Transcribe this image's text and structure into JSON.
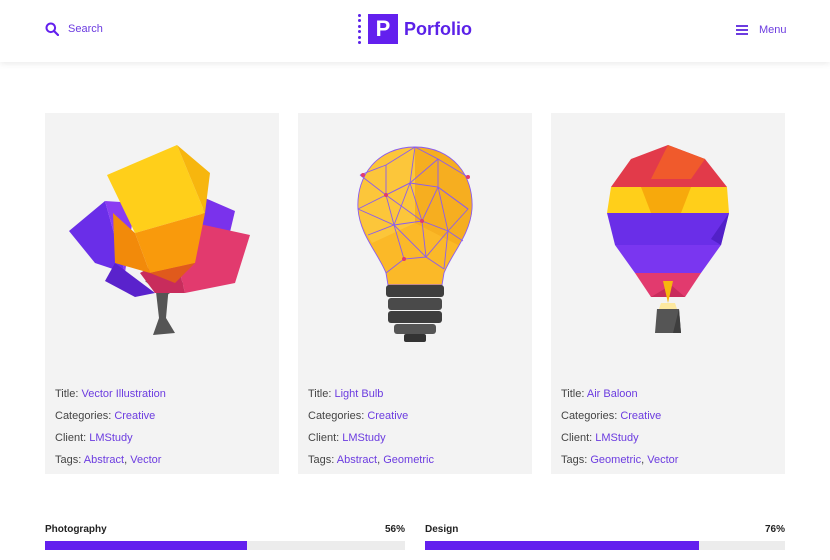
{
  "header": {
    "search_label": "Search",
    "logo_letter": "P",
    "logo_text": "Porfolio",
    "menu_label": "Menu",
    "accent_color": "#6320ee"
  },
  "cards": [
    {
      "image": "low-poly-tree",
      "title_label": "Title:",
      "title": "Vector Illustration",
      "categories_label": "Categories:",
      "categories": "Creative",
      "client_label": "Client:",
      "client": "LMStudy",
      "tags_label": "Tags:",
      "tags": [
        "Abstract",
        "Vector"
      ]
    },
    {
      "image": "low-poly-light-bulb",
      "title_label": "Title:",
      "title": "Light Bulb",
      "categories_label": "Categories:",
      "categories": "Creative",
      "client_label": "Client:",
      "client": "LMStudy",
      "tags_label": "Tags:",
      "tags": [
        "Abstract",
        "Geometric"
      ]
    },
    {
      "image": "low-poly-hot-air-balloon",
      "title_label": "Title:",
      "title": "Air Baloon",
      "categories_label": "Categories:",
      "categories": "Creative",
      "client_label": "Client:",
      "client": "LMStudy",
      "tags_label": "Tags:",
      "tags": [
        "Geometric",
        "Vector"
      ]
    }
  ],
  "skills": [
    {
      "name": "Photography",
      "percent_label": "56%",
      "percent": 0.56
    },
    {
      "name": "Design",
      "percent_label": "76%",
      "percent": 0.76
    }
  ]
}
